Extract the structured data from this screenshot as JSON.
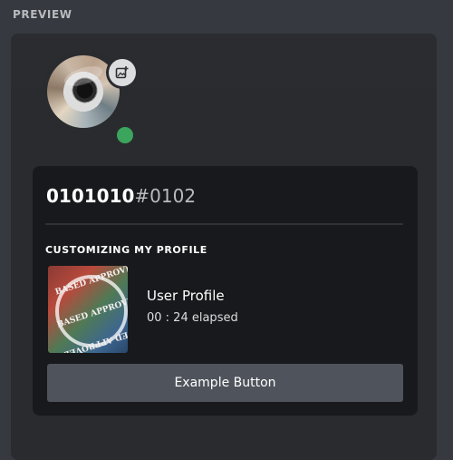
{
  "preview": {
    "label": "PREVIEW"
  },
  "profile": {
    "username": "0101010",
    "tag": "#0102",
    "avatar_icon": "game-disc-avatar",
    "edit_icon": "image-plus-icon",
    "status": {
      "color": "#3ba55d"
    }
  },
  "activity": {
    "header": "CUSTOMIZING MY PROFILE",
    "image_stamp": "BASED APPROVED",
    "title": "User Profile",
    "elapsed": "00 : 24 elapsed"
  },
  "button": {
    "label": "Example Button"
  }
}
